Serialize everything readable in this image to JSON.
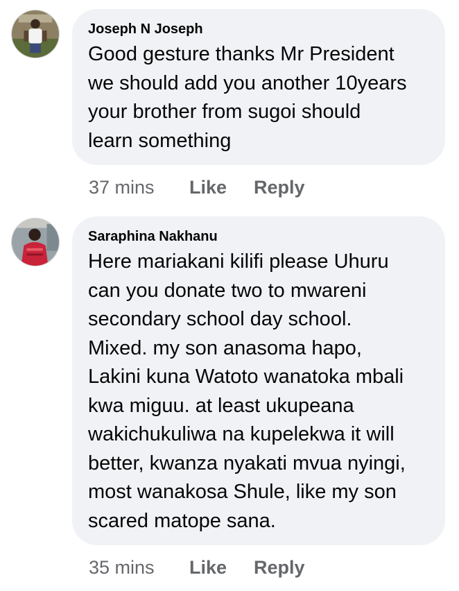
{
  "comments": [
    {
      "author": "Joseph N Joseph",
      "lines": [
        "Good gesture thanks Mr President",
        "we should add you another 10years",
        "your brother from sugoi should",
        "learn something"
      ],
      "time": "37 mins",
      "like_label": "Like",
      "reply_label": "Reply"
    },
    {
      "author": "Saraphina Nakhanu",
      "lines": [
        "Here mariakani kilifi please Uhuru",
        "can you donate two to mwareni",
        "secondary school day school.",
        "Mixed. my son anasoma hapo,",
        "Lakini kuna Watoto wanatoka mbali",
        "kwa miguu. at least ukupeana",
        "wakichukuliwa na kupelekwa it will",
        "better, kwanza nyakati mvua  nyingi,",
        "most wanakosa Shule, like my son",
        "scared matope sana."
      ],
      "time": "35 mins",
      "like_label": "Like",
      "reply_label": "Reply"
    }
  ]
}
